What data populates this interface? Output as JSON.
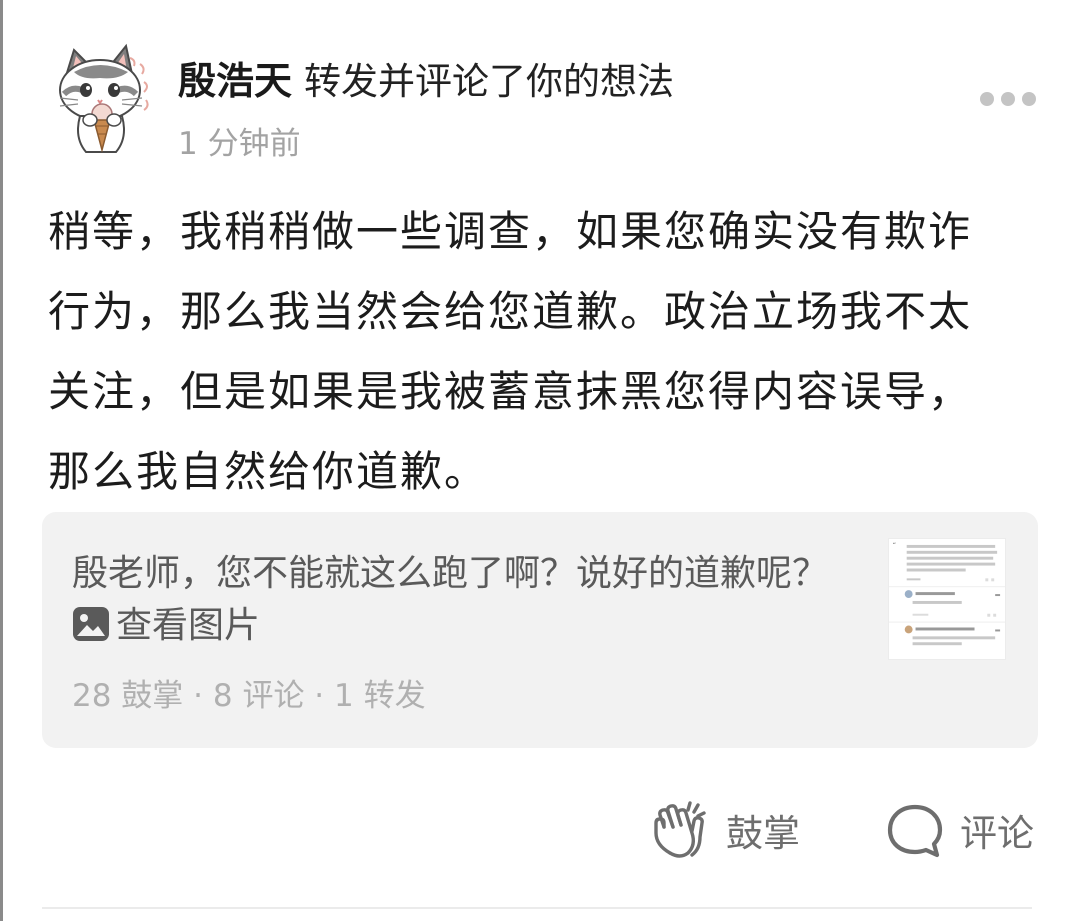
{
  "post": {
    "author_name": "殷浩天",
    "action_text": "转发并评论了你的想法",
    "timestamp": "1 分钟前",
    "body": "稍等，我稍稍做一些调查，如果您确实没有欺诈行为，那么我当然会给您道歉。政治立场我不太关注，但是如果是我被蓄意抹黑您得内容误导，那么我自然给你道歉。"
  },
  "quoted": {
    "text": "殷老师，您不能就这么跑了啊？说好的道歉呢？",
    "image_link": "查看图片",
    "stats": "28 鼓掌 · 8 评论 · 1 转发"
  },
  "actions": {
    "clap_label": "鼓掌",
    "comment_label": "评论"
  },
  "icons": {
    "avatar": "cat-eating-ice-cream-avatar",
    "more": "more-dots-icon",
    "image": "image-icon",
    "clap": "clap-icon",
    "comment": "comment-bubble-icon"
  },
  "colors": {
    "text_primary": "#1c1c1c",
    "text_secondary": "#a3a3a3",
    "card_background": "#f2f2f2",
    "action_gray": "#6e6e6e"
  }
}
